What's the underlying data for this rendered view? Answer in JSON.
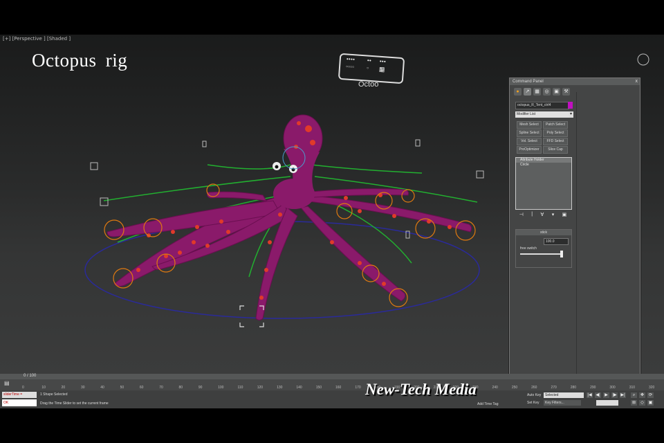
{
  "viewport": {
    "label": "[+] [Perspective ] [Shaded ]",
    "title": "Octopus  rig",
    "controller_name": "Octoo",
    "controller_labels": [
      "",
      "",
      ""
    ]
  },
  "command_panel": {
    "title": "Command Panel",
    "close": "x",
    "tabs": [
      "●",
      "↗",
      "▦",
      "◎",
      "▣",
      "⚒"
    ],
    "object_name": "octopus_R_Tent_ctrl4",
    "object_color": "#c010c0",
    "modifier_list": "Modifier List",
    "modifier_buttons": [
      "Mesh Select",
      "Patch Select",
      "Spline Select",
      "Poly Select",
      "Vol. Select",
      "FFD Select",
      "ProOptimizer",
      "Slice Cap"
    ],
    "stack_items": [
      "Attribute Holder",
      "Circle"
    ],
    "stack_tools": [
      "⊣",
      "|",
      "∀",
      "▾",
      "▣"
    ],
    "rollout": {
      "title": "stick",
      "value": "100.0",
      "label": "free switch"
    }
  },
  "timeline": {
    "position": "0 / 100",
    "ticks": [
      "0",
      "10",
      "20",
      "30",
      "40",
      "50",
      "60",
      "70",
      "80",
      "90",
      "100",
      "110",
      "120",
      "130",
      "140",
      "150",
      "160",
      "170",
      "180",
      "190",
      "200",
      "210",
      "220",
      "230",
      "240",
      "250",
      "260",
      "270",
      "280",
      "290",
      "300",
      "310",
      "320"
    ]
  },
  "status": {
    "listener_top": "sliderTime =",
    "listener_bottom": "OK",
    "selection": "1 Shape Selected",
    "prompt": "Drag the Time Slider to set the current frame",
    "add_time_tag": "Add Time Tag",
    "auto_key": "Auto Key",
    "set_key": "Set Key",
    "selected_option": "Selected",
    "key_filters": "Key Filters...",
    "playback": [
      "|◀",
      "◀|",
      "▶",
      "|▶",
      "▶|"
    ]
  },
  "watermark": "New-Tech Media",
  "colors": {
    "octopus": "#8a1a6a",
    "spots": "#e03a2a",
    "controls_green": "#22b030",
    "controls_orange": "#e07a10",
    "ground_circle": "#2a2a9a"
  }
}
